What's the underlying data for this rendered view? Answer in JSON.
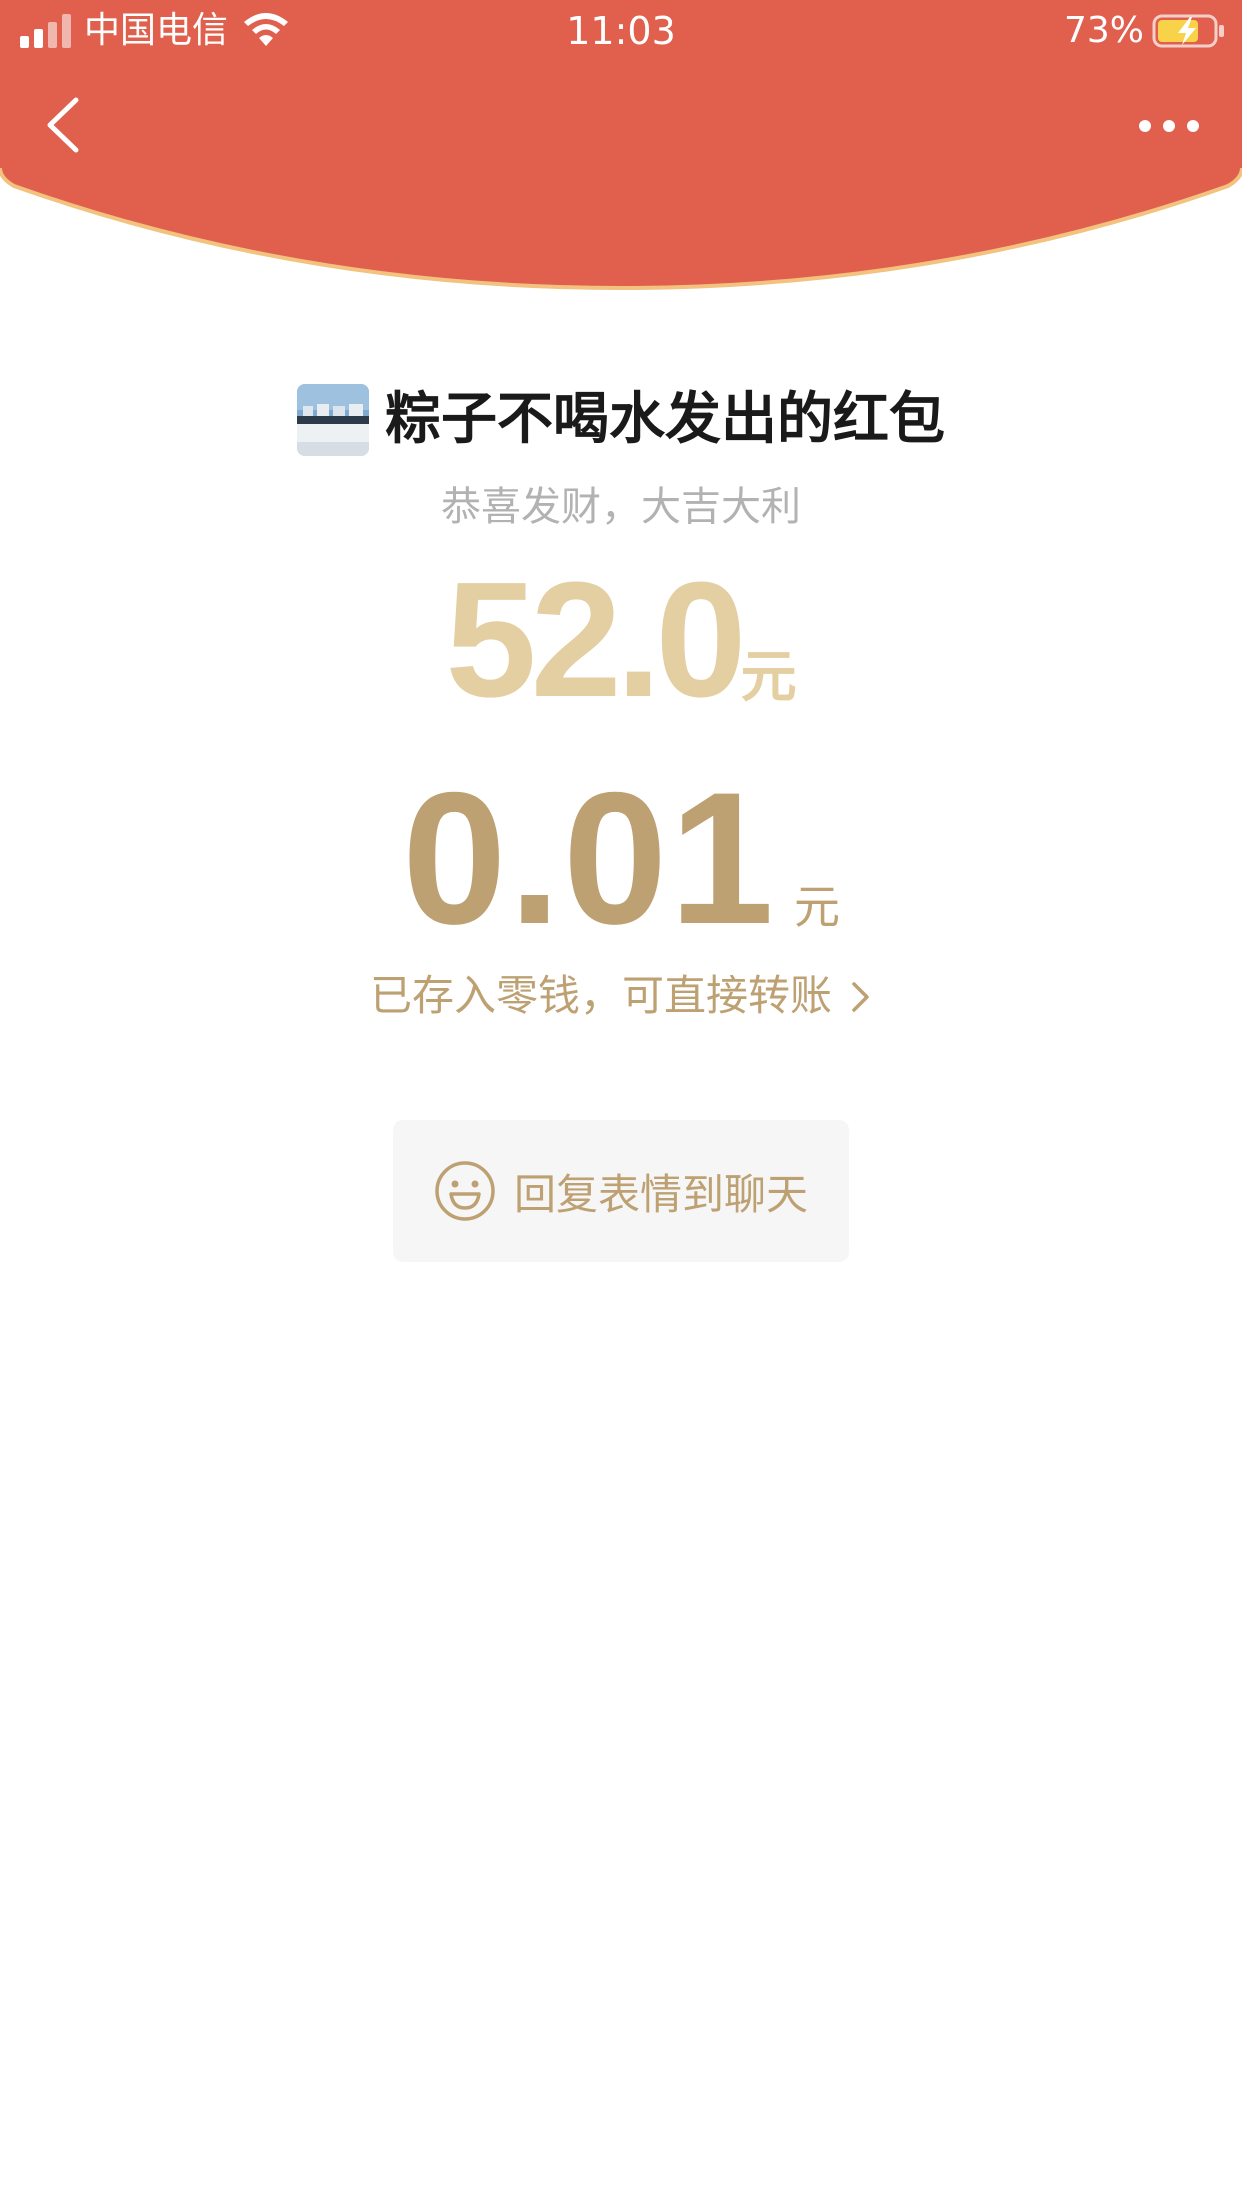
{
  "status_bar": {
    "carrier": "中国电信",
    "time": "11:03",
    "battery": "73%"
  },
  "nav": {
    "back_icon": "chevron-left-icon",
    "more_icon": "more-horizontal-icon"
  },
  "colors": {
    "header_red": "#e0604d",
    "header_rim": "#f2c27e",
    "gold_light": "#e4cfa2",
    "gold": "#bea172",
    "button_bg": "#f6f6f6"
  },
  "envelope": {
    "sender_title": "粽子不喝水发出的红包",
    "blessing": "恭喜发财，大吉大利",
    "cover_amount": "52.0",
    "cover_unit": "元",
    "received_amount": "0.01",
    "received_unit": "元",
    "change_link": "已存入零钱，可直接转账"
  },
  "reply": {
    "label": "回复表情到聊天",
    "icon": "smiley-icon"
  }
}
